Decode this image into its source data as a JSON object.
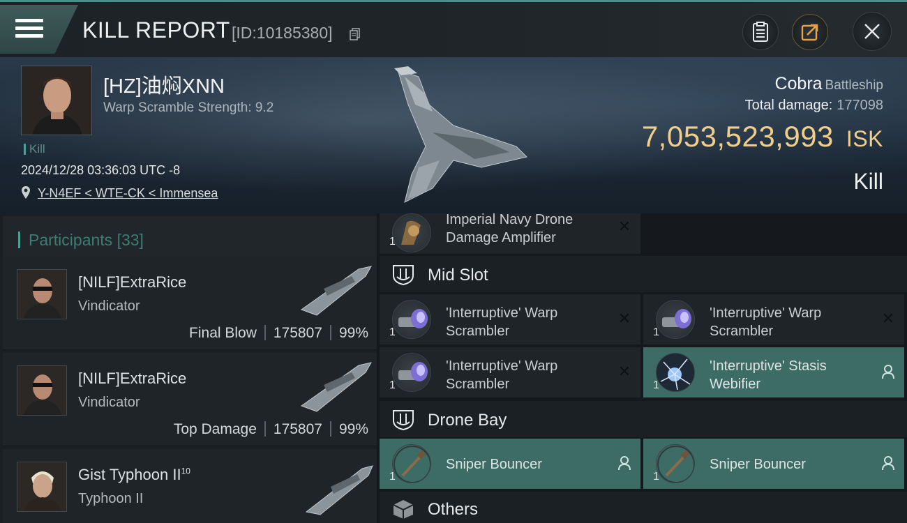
{
  "header": {
    "title": "KILL REPORT",
    "report_id": "[ID:10185380]"
  },
  "victim": {
    "name": "[HZ]油焖XNN",
    "warp_scramble": "Warp Scramble Strength: 9.2",
    "kill_tag": "Kill",
    "datetime": "2024/12/28 03:36:03 UTC -8",
    "location": "Y-N4EF < WTE-CK < Immensea",
    "ship_name": "Cobra",
    "ship_class": "Battleship",
    "total_damage_label": "Total damage:",
    "total_damage": "177098",
    "isk_value": "7,053,523,993",
    "isk_unit": "ISK",
    "result": "Kill"
  },
  "participants": {
    "title": "Participants",
    "count": "[33]",
    "list": [
      {
        "name": "[NILF]ExtraRice",
        "ship": "Vindicator",
        "role": "Final Blow",
        "damage": "175807",
        "percent": "99%"
      },
      {
        "name": "[NILF]ExtraRice",
        "ship": "Vindicator",
        "role": "Top Damage",
        "damage": "175807",
        "percent": "99%"
      },
      {
        "name": "Gist Typhoon II",
        "name_sup": "10",
        "ship": "Typhoon II"
      }
    ]
  },
  "fittings": {
    "low_item": {
      "qty": "1",
      "name": "Imperial Navy Drone Damage Amplifier",
      "status": "destroyed"
    },
    "mid_slot": {
      "label": "Mid Slot",
      "items": [
        {
          "qty": "1",
          "name": "'Interruptive' Warp Scrambler",
          "status": "destroyed"
        },
        {
          "qty": "1",
          "name": "'Interruptive' Warp Scrambler",
          "status": "destroyed"
        },
        {
          "qty": "1",
          "name": "'Interruptive' Warp Scrambler",
          "status": "destroyed"
        },
        {
          "qty": "1",
          "name": "'Interruptive' Stasis Webifier",
          "status": "dropped"
        }
      ]
    },
    "drone_bay": {
      "label": "Drone Bay",
      "items": [
        {
          "qty": "1",
          "name": "Sniper  Bouncer",
          "status": "dropped"
        },
        {
          "qty": "1",
          "name": "Sniper  Bouncer",
          "status": "dropped"
        }
      ]
    },
    "others": {
      "label": "Others"
    }
  },
  "colors": {
    "accent_teal": "#4ea096",
    "isk_gold": "#f1cf8a",
    "dropped_bg": "#3d6b66"
  },
  "icons": {
    "menu": "hamburger-icon",
    "copy": "copy-icon",
    "clipboard": "clipboard-icon",
    "share": "share-icon",
    "close": "close-icon",
    "location": "location-pin-icon",
    "destroyed": "x-icon",
    "dropped": "person-icon",
    "slot": "slot-shield-icon",
    "others": "cube-icon"
  }
}
